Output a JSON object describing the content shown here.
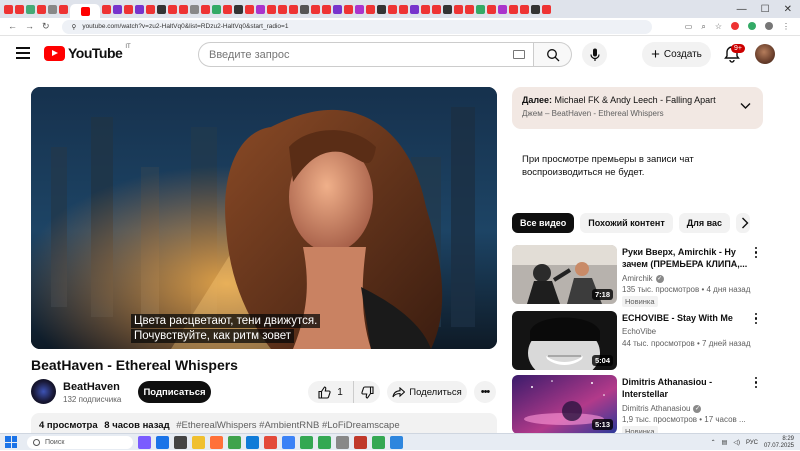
{
  "browser": {
    "url": "youtube.com/watch?v=zu2-HaltVq0&list=RDzu2-HaltVq0&start_radio=1"
  },
  "header": {
    "logo_text": "YouTube",
    "region": "IT",
    "search_placeholder": "Введите запрос",
    "create_label": "Создать",
    "notifications_badge": "9+"
  },
  "player": {
    "subtitle_lines": [
      "Цвета расцветают, тени движутся.",
      "Почувствуйте, как ритм зовет"
    ]
  },
  "video": {
    "title": "BeatHaven - Ethereal Whispers",
    "channel_name": "BeatHaven",
    "subscribers": "132 подписчика",
    "subscribe_label": "Подписаться",
    "like_count": "1",
    "share_label": "Поделиться",
    "views": "4 просмотра",
    "published": "8 часов назад",
    "tags": "#EtherealWhispers #AmbientRNB #LoFiDreamscape"
  },
  "up_next": {
    "prefix": "Далее:",
    "title": "Michael FK & Andy Leech - Falling Apart",
    "subtitle": "Джем – BeatHaven - Ethereal Whispers"
  },
  "premiere_note": "При просмотре премьеры в записи чат воспроизводиться не будет.",
  "chips": [
    "Все видео",
    "Похожий контент",
    "Для вас"
  ],
  "recommendations": [
    {
      "title": "Руки Вверх, Amirchik - Ну зачем (ПРЕМЬЕРА КЛИПА,...",
      "channel": "Amirchik",
      "verified": true,
      "meta": "135 тыс. просмотров • 4 дня назад",
      "badge": "Новинка",
      "duration": "7:18"
    },
    {
      "title": "ECHOVIBE - Stay With Me",
      "channel": "EchoVibe",
      "verified": false,
      "meta": "44 тыс. просмотров • 7 дней назад",
      "badge": "",
      "duration": "5:04"
    },
    {
      "title": "Dimitris Athanasiou - Interstellar",
      "channel": "Dimitris Athanasiou",
      "verified": true,
      "meta": "1,9 тыс. просмотров • 17 часов ...",
      "badge": "Новинка",
      "duration": "5:13"
    }
  ],
  "taskbar": {
    "search_label": "Поиск",
    "language": "РУС",
    "time": "8:29",
    "date": "07.07.2025"
  },
  "colors": {
    "brand_red": "#ff0000",
    "up_next_bg": "#f2e8e3",
    "chip_active": "#0f0f0f"
  }
}
